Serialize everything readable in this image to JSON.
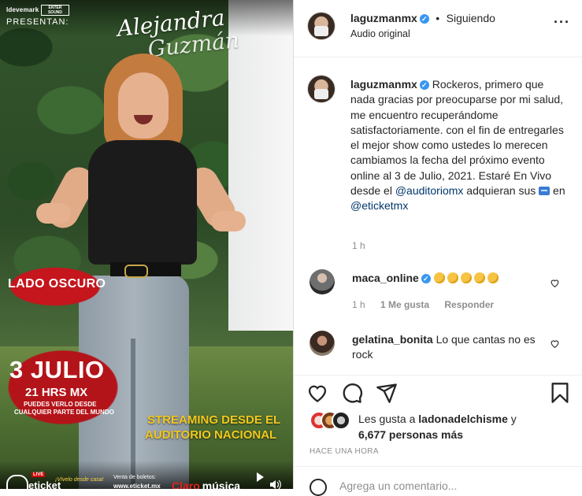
{
  "media": {
    "brand_left": "Idevemark",
    "brand_right": "ENTER SOUND",
    "presentan": "PRESENTAN:",
    "signature_line1": "Alejandra",
    "signature_line2": "Guzmán",
    "lado_oscuro": "LADO OSCURO",
    "date": "3 JULIO",
    "time": "21 HRS MX",
    "puedes_line1": "PUEDES VERLO DESDE",
    "puedes_line2": "CUALQUIER PARTE DEL MUNDO",
    "streaming_line1": "STREAMING DESDE EL",
    "streaming_line2": "AUDITORIO NACIONAL",
    "live_tag": "LIVE",
    "eticket": "eticket",
    "adquiere": "¡Vívelo desde casa!",
    "venta_label": "Venta de boletos:",
    "venta_url": "www.eticket.mx",
    "claro": "Claro",
    "claro_suffix": "música"
  },
  "header": {
    "username": "laguzmanmx",
    "dot": "•",
    "following": "Siguiendo",
    "audio": "Audio original",
    "more": "···"
  },
  "caption": {
    "username": "laguzmanmx",
    "text_part1": "Rockeros, primero que nada gracias por preocuparse por mi salud, me encuentro recuperándome satisfactoriamente. con el fin de entregarles el mejor show como ustedes lo merecen cambiamos la fecha del próximo evento online al 3 de Julio, 2021. Estaré En Vivo desde el",
    "mention1": "@auditoriomx",
    "text_part2": "adquieran sus",
    "text_part3": "en",
    "mention2": "@eticketmx",
    "time": "1 h"
  },
  "comments": [
    {
      "username": "maca_online",
      "time": "1 h",
      "likes": "1 Me gusta",
      "reply": "Responder"
    },
    {
      "username": "gelatina_bonita",
      "text": "Lo que cantas no es rock"
    }
  ],
  "likes": {
    "prefix": "Les gusta a",
    "user": "ladonadelchisme",
    "suffix": "y",
    "others": "6,677 personas más"
  },
  "time_ago": "HACE UNA HORA",
  "add_comment_placeholder": "Agrega un comentario...",
  "icons": {
    "verified": "verified-badge-icon",
    "like": "heart-icon",
    "comment": "comment-bubble-icon",
    "share": "paper-plane-icon",
    "save": "bookmark-icon",
    "emoji": "emoji-icon",
    "clap": "clapping-hands-emoji",
    "ticket": "ticket-emoji"
  },
  "colors": {
    "link": "#00376b",
    "verified": "#3897f0",
    "muted": "#8e8e8e",
    "promo_yellow": "#f2c81d",
    "promo_red": "#c4161c"
  }
}
